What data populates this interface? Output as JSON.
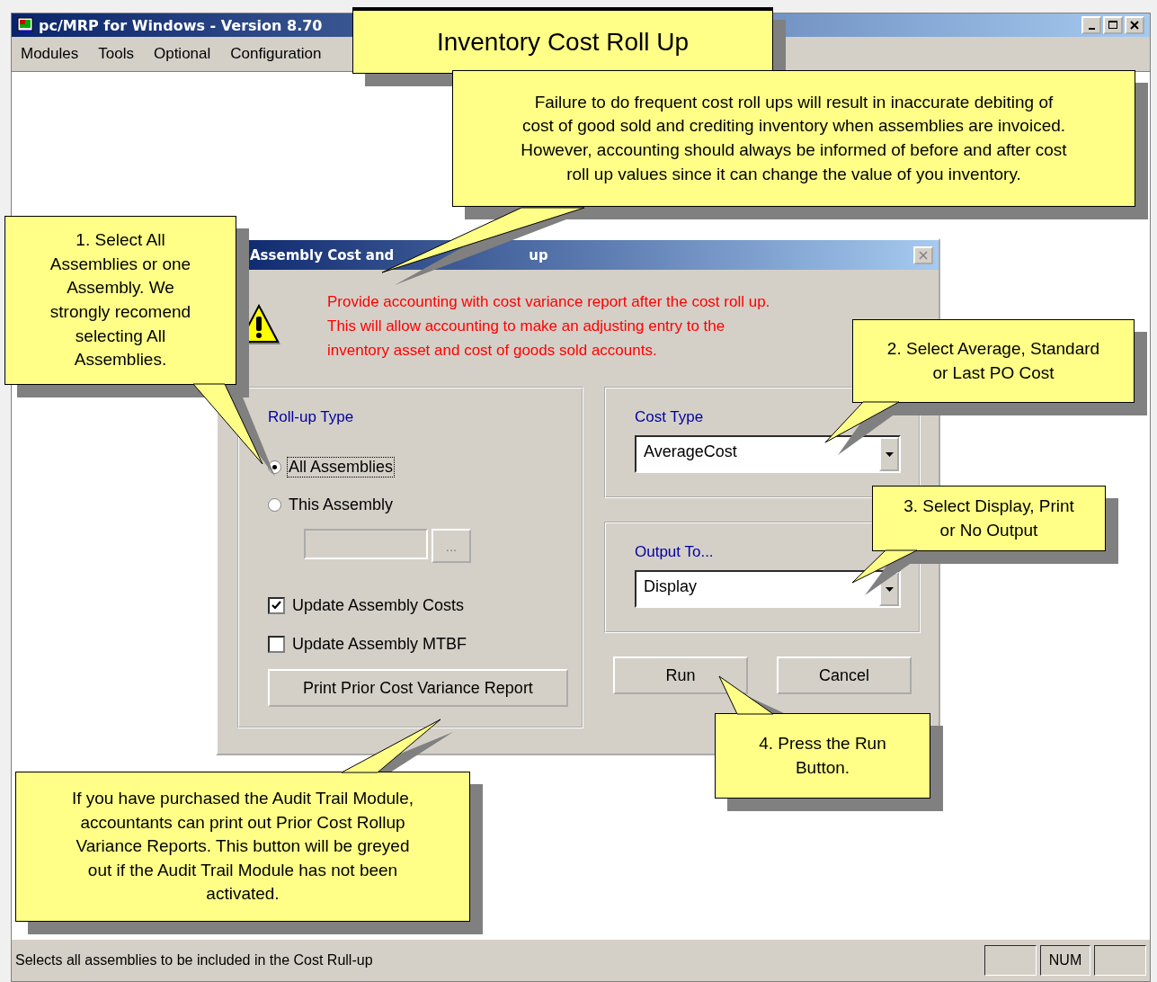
{
  "window": {
    "title": "pc/MRP for Windows - Version 8.70"
  },
  "menu": [
    {
      "label": "Modules"
    },
    {
      "label": "Tools"
    },
    {
      "label": "Optional"
    },
    {
      "label": "Configuration"
    }
  ],
  "dialog": {
    "title_start": "Assembly Cost and",
    "title_end": "up",
    "message_lines": [
      "Provide accounting with cost variance report after the cost roll up.",
      "This will allow accounting to make an adjusting entry to the",
      "inventory asset and cost of goods sold accounts."
    ],
    "rollup": {
      "label": "Roll-up Type",
      "options": [
        {
          "label": "All Assemblies",
          "selected": true
        },
        {
          "label": "This Assembly",
          "selected": false
        }
      ],
      "browse_button": "...",
      "checkboxes": [
        {
          "label": "Update Assembly Costs",
          "checked": true
        },
        {
          "label": "Update Assembly MTBF",
          "checked": false
        }
      ],
      "print_button": "Print Prior Cost Variance Report"
    },
    "cost_type": {
      "label": "Cost Type",
      "value": "AverageCost"
    },
    "output_to": {
      "label": "Output To...",
      "value": "Display"
    },
    "buttons": [
      "Run",
      "Cancel"
    ]
  },
  "headline": "Inventory Cost Roll Up",
  "callouts": [
    {
      "lines": [
        "Failure to do frequent cost roll ups will result in inaccurate debiting of",
        "cost of good sold and crediting inventory when assemblies are invoiced.",
        "However, accounting should always be informed of before and after cost",
        "roll up values since it can change the value of you inventory."
      ]
    },
    {
      "lines": [
        "1. Select All",
        "Assemblies or one",
        "Assembly.  We",
        "strongly recomend",
        "selecting All",
        "Assemblies."
      ]
    },
    {
      "lines": [
        "2. Select Average, Standard",
        "or Last PO Cost"
      ]
    },
    {
      "lines": [
        "3. Select Display, Print",
        "or No Output"
      ]
    },
    {
      "lines": [
        "4. Press the Run",
        "Button."
      ]
    },
    {
      "lines": [
        "If you have purchased the Audit Trail Module,",
        "accountants can print out Prior Cost Rollup",
        "Variance Reports.  This button will be greyed",
        "out if the Audit Trail Module has not been",
        "activated."
      ]
    }
  ],
  "status_bar": {
    "text": "Selects all assemblies to be included in the Cost Rull-up",
    "indicator": "NUM"
  }
}
